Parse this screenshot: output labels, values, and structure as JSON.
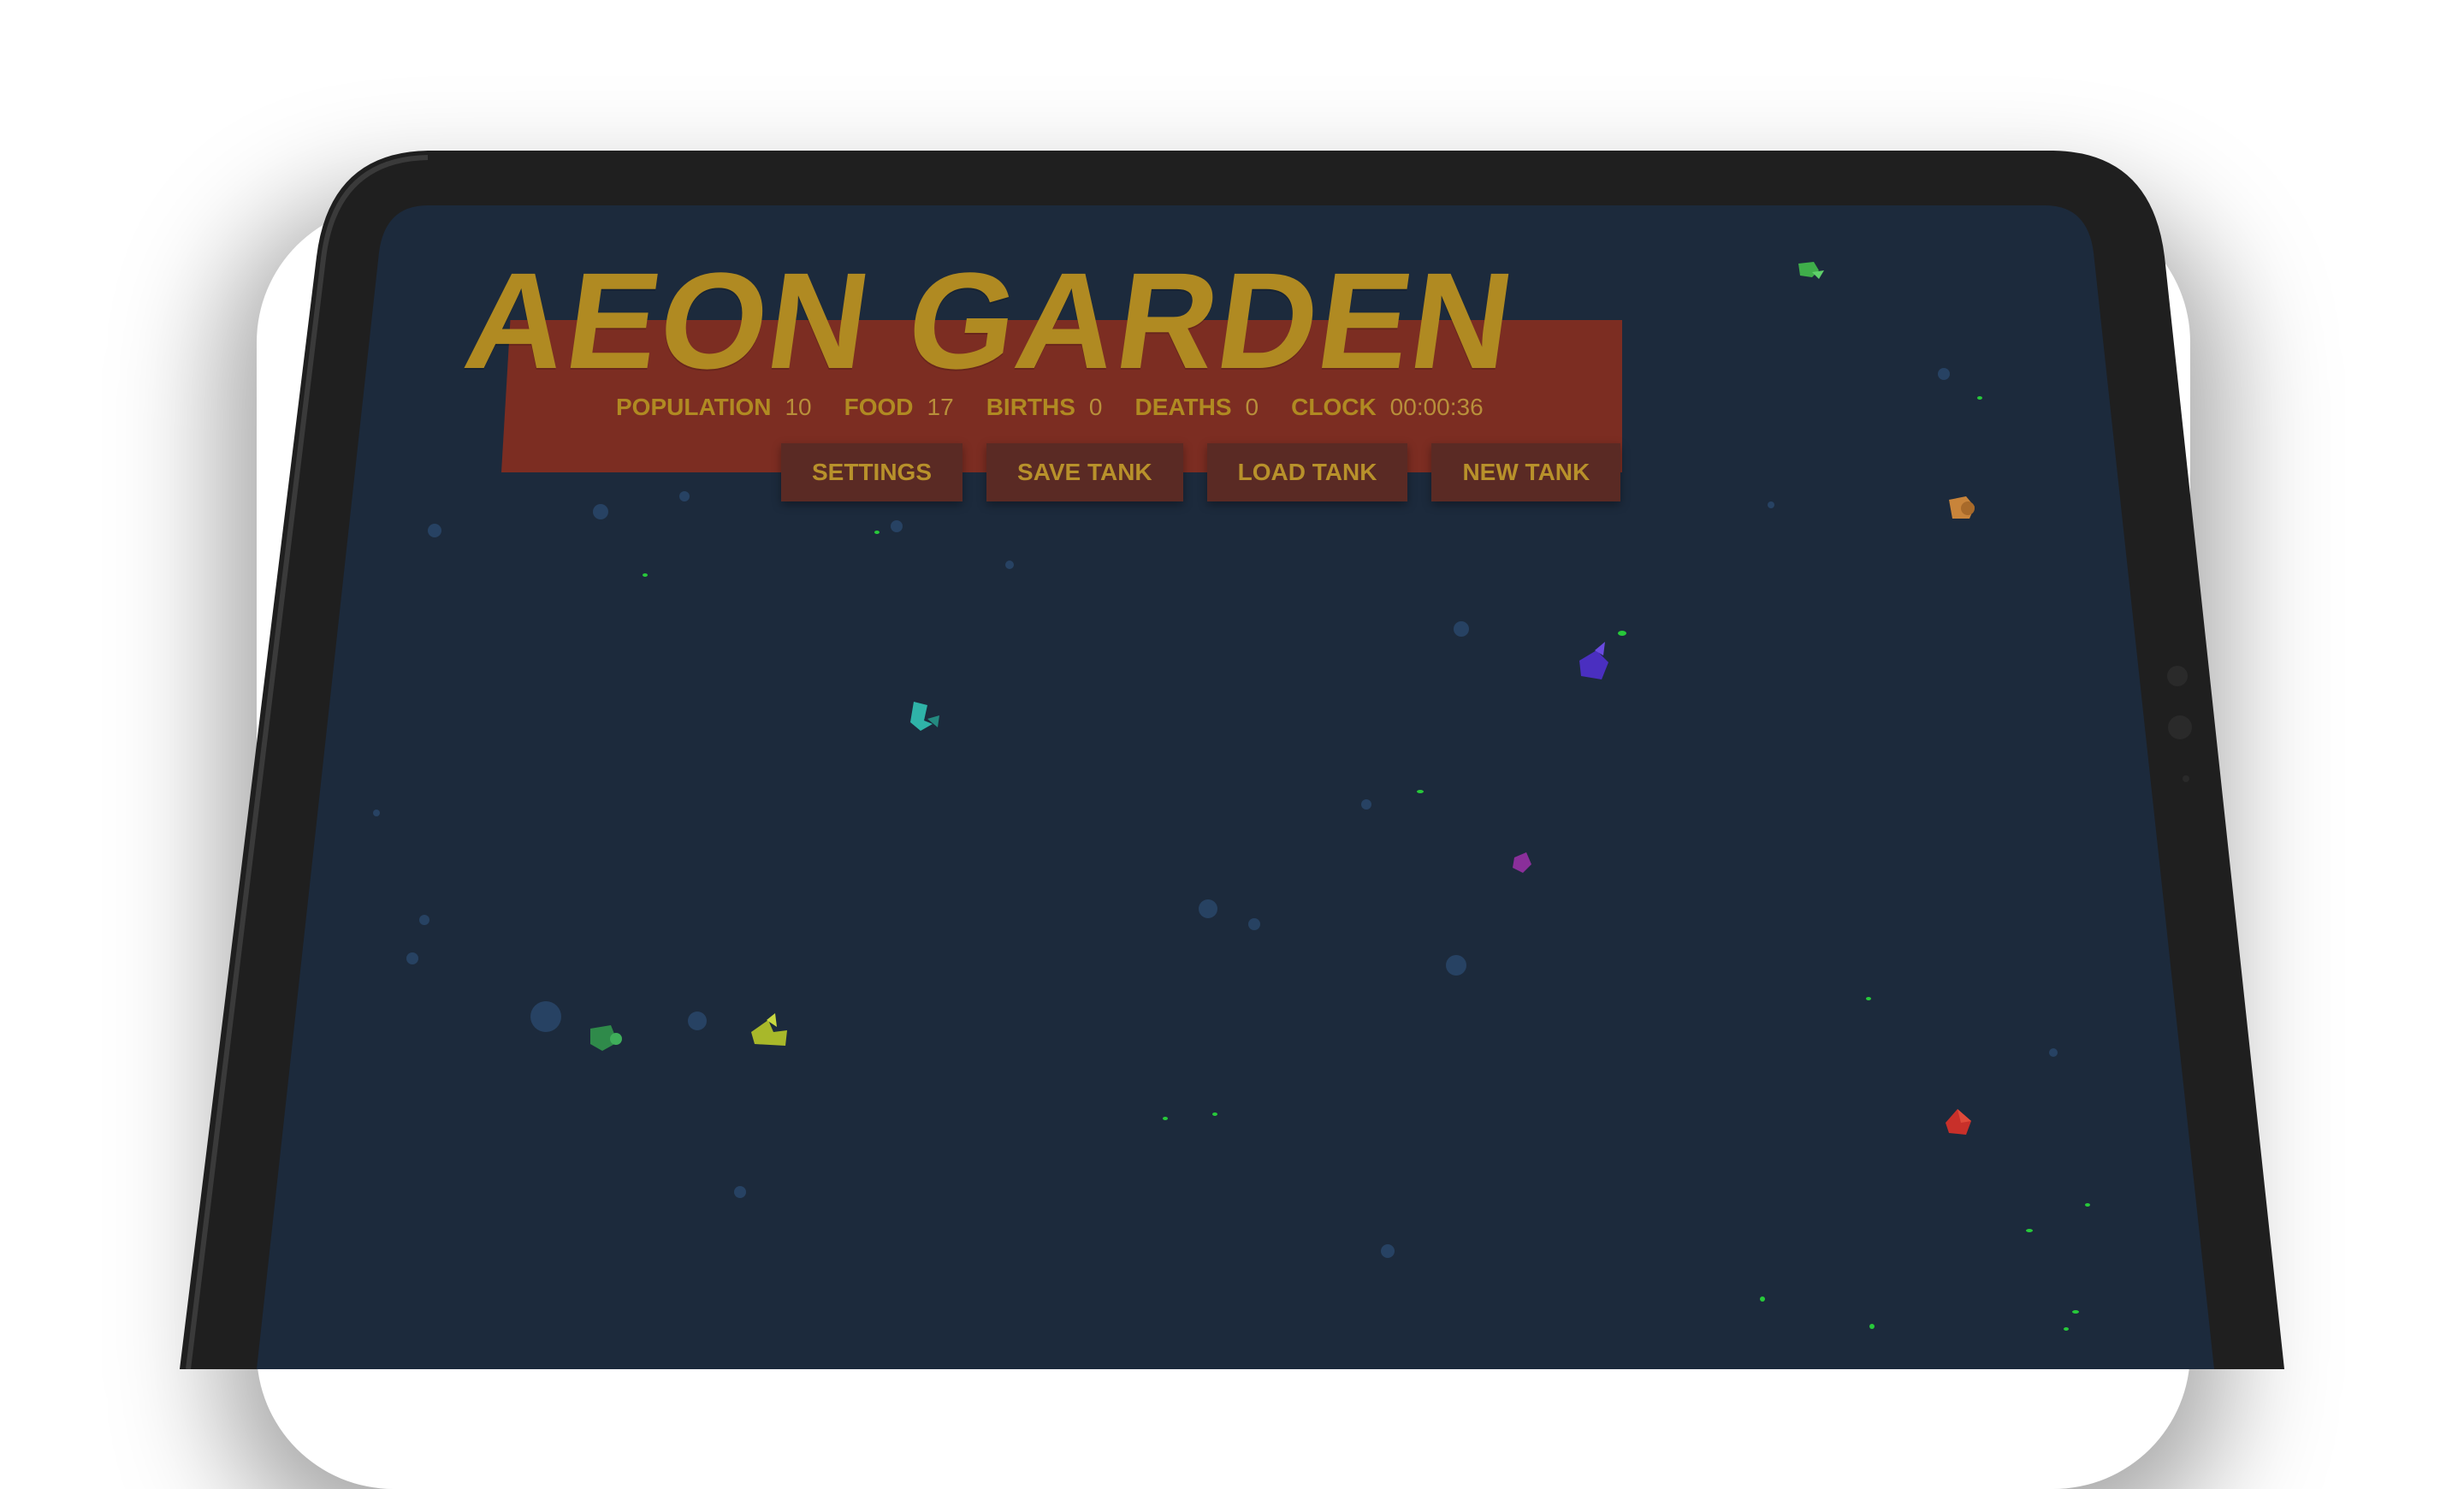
{
  "app": {
    "title": "AEON GARDEN"
  },
  "stats": [
    {
      "label": "POPULATION",
      "value": "10"
    },
    {
      "label": "FOOD",
      "value": "17"
    },
    {
      "label": "BIRTHS",
      "value": "0"
    },
    {
      "label": "DEATHS",
      "value": "0"
    },
    {
      "label": "CLOCK",
      "value": "00:00:36"
    }
  ],
  "menu": {
    "settings_label": "SETTINGS",
    "save_label": "SAVE TANK",
    "load_label": "LOAD TANK",
    "new_label": "NEW TANK"
  },
  "colors": {
    "tank_background": "#1c2a3c",
    "banner": "#7c2d22",
    "title_gold": "#b08a22",
    "button_bg": "#5a2a24",
    "bezel": "#1f1f1f"
  },
  "creatures": [
    {
      "color": "#3fae4a"
    },
    {
      "color": "#c8843a"
    },
    {
      "color": "#4a2fc0"
    },
    {
      "color": "#2fb3a8"
    },
    {
      "color": "#8a2f9a"
    },
    {
      "color": "#2f8a4a"
    },
    {
      "color": "#a8b82a"
    },
    {
      "color": "#c8302a"
    }
  ]
}
